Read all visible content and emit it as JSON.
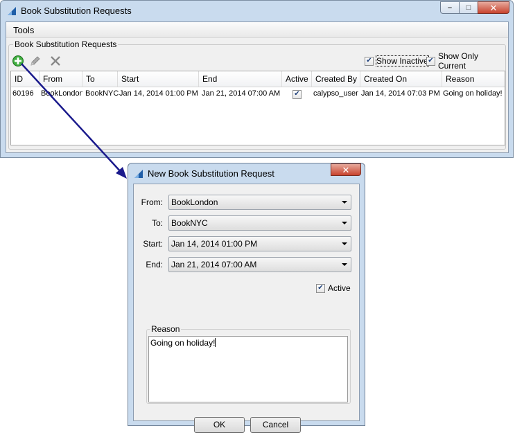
{
  "main_window": {
    "title": "Book Substitution Requests",
    "menu": [
      "Tools"
    ],
    "panel_title": "Book Substitution Requests",
    "toolbar": {
      "add_icon": "add-circle-icon",
      "edit_icon": "pencil-icon",
      "delete_icon": "x-icon"
    },
    "filters": {
      "show_inactive": {
        "label": "Show Inactive",
        "checked": true
      },
      "show_only_current": {
        "label": "Show Only Current",
        "checked": true
      }
    },
    "table": {
      "columns": [
        "ID",
        "From",
        "To",
        "Start",
        "End",
        "Active",
        "Created By",
        "Created On",
        "Reason"
      ],
      "rows": [
        {
          "id": "60196",
          "from": "BookLondon",
          "to": "BookNYC",
          "start": "Jan 14, 2014 01:00 PM",
          "end": "Jan 21, 2014 07:00 AM",
          "active": true,
          "created_by": "calypso_user",
          "created_on": "Jan 14, 2014 07:03 PM",
          "reason": "Going on holiday!"
        }
      ]
    }
  },
  "dialog": {
    "title": "New Book Substitution Request",
    "fields": {
      "from": {
        "label": "From:",
        "value": "BookLondon"
      },
      "to": {
        "label": "To:",
        "value": "BookNYC"
      },
      "start": {
        "label": "Start:",
        "value": "Jan 14, 2014 01:00 PM"
      },
      "end": {
        "label": "End:",
        "value": "Jan 21, 2014 07:00 AM"
      }
    },
    "active": {
      "label": "Active",
      "checked": true
    },
    "reason": {
      "label": "Reason",
      "value": "Going on holiday!"
    },
    "ok_label": "OK",
    "cancel_label": "Cancel"
  },
  "colors": {
    "window_frame": "#c9dbee",
    "arrow": "#1a1a8c",
    "add_icon": "#2e9e2e",
    "close_button": "#c8432e"
  }
}
